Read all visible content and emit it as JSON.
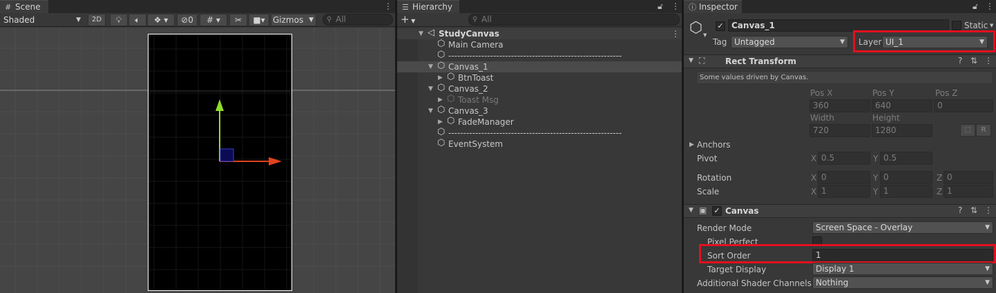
{
  "scene": {
    "tab_label": "Scene",
    "shading_mode": "Shaded",
    "mode_2d": "2D",
    "hidden_count": "0",
    "gizmos_label": "Gizmos",
    "search_placeholder": "All"
  },
  "hierarchy": {
    "tab_label": "Hierarchy",
    "search_placeholder": "All",
    "items": [
      {
        "label": "StudyCanvas",
        "indent": 0,
        "expander": "open",
        "scene": true
      },
      {
        "label": "Main Camera",
        "indent": 1,
        "expander": "none"
      },
      {
        "label": "----------------------------------------------------------",
        "indent": 1,
        "expander": "none"
      },
      {
        "label": "Canvas_1",
        "indent": 1,
        "expander": "open",
        "selected": true
      },
      {
        "label": "BtnToast",
        "indent": 2,
        "expander": "closed"
      },
      {
        "label": "Canvas_2",
        "indent": 1,
        "expander": "open"
      },
      {
        "label": "Toast Msg",
        "indent": 2,
        "expander": "closed",
        "inactive": true
      },
      {
        "label": "Canvas_3",
        "indent": 1,
        "expander": "open"
      },
      {
        "label": "FadeManager",
        "indent": 2,
        "expander": "closed"
      },
      {
        "label": "----------------------------------------------------------",
        "indent": 1,
        "expander": "none"
      },
      {
        "label": "EventSystem",
        "indent": 1,
        "expander": "none"
      }
    ]
  },
  "inspector": {
    "tab_label": "Inspector",
    "object_name": "Canvas_1",
    "static_label": "Static",
    "tag_label": "Tag",
    "tag_value": "Untagged",
    "layer_label": "Layer",
    "layer_value": "UI_1",
    "rect_transform": {
      "title": "Rect Transform",
      "note": "Some values driven by Canvas.",
      "pos_x_label": "Pos X",
      "pos_y_label": "Pos Y",
      "pos_z_label": "Pos Z",
      "pos_x": "360",
      "pos_y": "640",
      "pos_z": "0",
      "width_label": "Width",
      "height_label": "Height",
      "width": "720",
      "height": "1280",
      "r_label": "R",
      "anchors_label": "Anchors",
      "pivot_label": "Pivot",
      "pivot_x": "0.5",
      "pivot_y": "0.5",
      "rotation_label": "Rotation",
      "rot_x": "0",
      "rot_y": "0",
      "rot_z": "0",
      "scale_label": "Scale",
      "scale_x": "1",
      "scale_y": "1",
      "scale_z": "1",
      "x_label": "X",
      "y_label": "Y",
      "z_label": "Z"
    },
    "canvas": {
      "title": "Canvas",
      "render_mode_label": "Render Mode",
      "render_mode_value": "Screen Space - Overlay",
      "pixel_perfect_label": "Pixel Perfect",
      "sort_order_label": "Sort Order",
      "sort_order_value": "1",
      "target_display_label": "Target Display",
      "target_display_value": "Display 1",
      "shader_channels_label": "Additional Shader Channels",
      "shader_channels_value": "Nothing"
    }
  },
  "colors": {
    "highlight": "#e3101d",
    "x_axis": "#e0421e",
    "y_axis": "#8fdc2c"
  }
}
